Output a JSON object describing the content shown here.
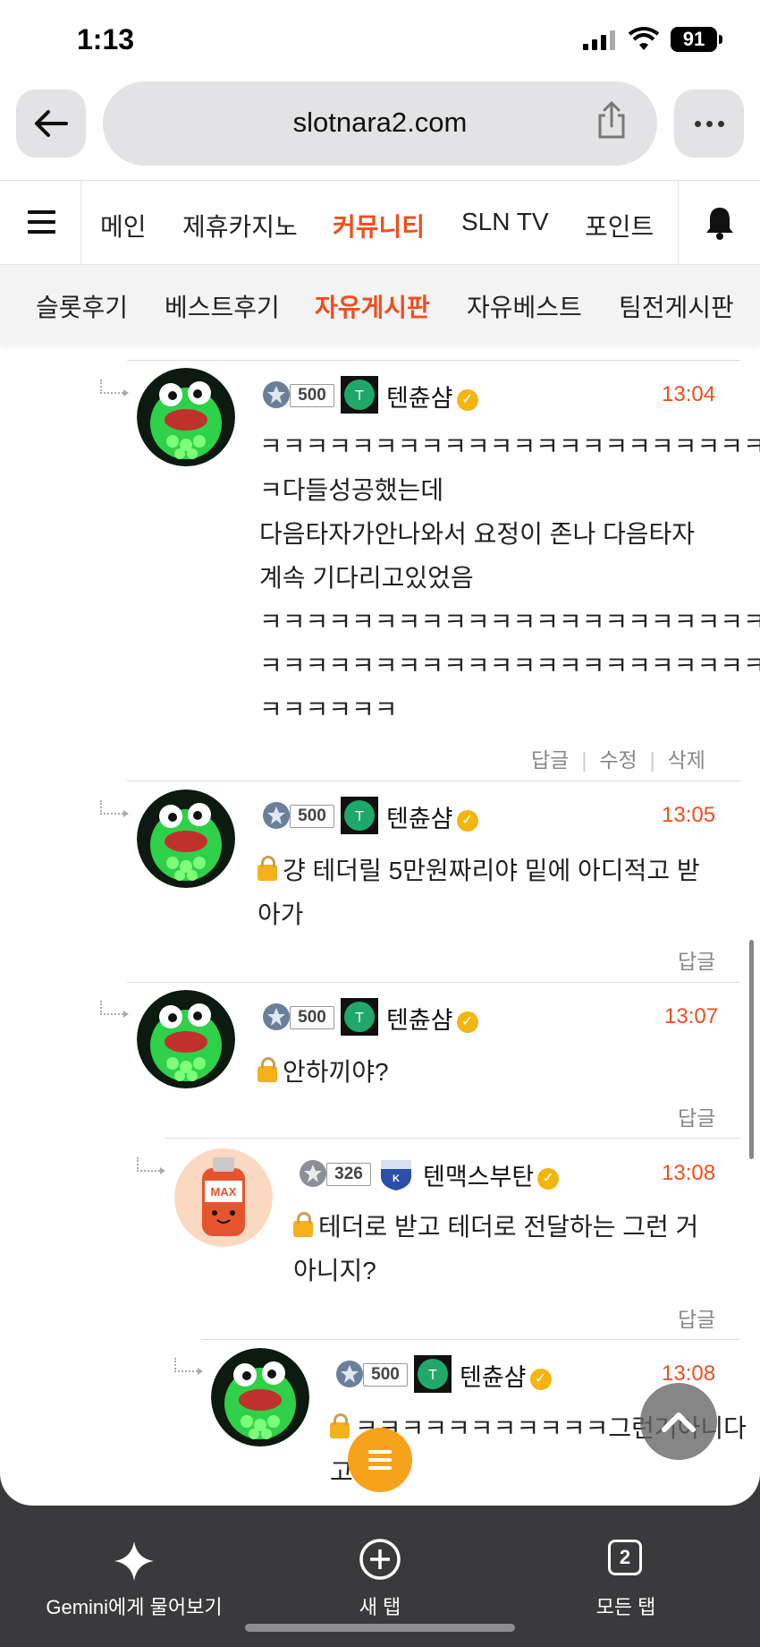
{
  "status_bar": {
    "time": "1:13",
    "battery": "91"
  },
  "browser": {
    "url": "slotnara2.com"
  },
  "nav": {
    "items": [
      "메인",
      "제휴카지노",
      "커뮤니티",
      "SLN TV",
      "포인트"
    ],
    "active": "커뮤니티"
  },
  "subnav": {
    "items": [
      "슬롯후기",
      "베스트후기",
      "자유게시판",
      "자유베스트",
      "팀전게시판"
    ],
    "active": "자유게시판"
  },
  "comments": [
    {
      "level": "500",
      "username": "텐츈샴",
      "time": "13:04",
      "locked": false,
      "lines": [
        "ㅋㅋㅋㅋㅋㅋㅋㅋㅋㅋㅋㅋㅋㅋㅋㅋㅋㅋㅋㅋㅋㅋㅋ",
        "ㅋ다들성공했는데",
        "다음타자가안나와서 요정이 존나 다음타자",
        "계속 기다리고있었음",
        "ㅋㅋㅋㅋㅋㅋㅋㅋㅋㅋㅋㅋㅋㅋㅋㅋㅋㅋㅋㅋㅋㅋㅋ",
        "ㅋㅋㅋㅋㅋㅋㅋㅋㅋㅋㅋㅋㅋㅋㅋㅋㅋㅋㅋㅋㅋㅋㅋ",
        "ㅋㅋㅋㅋㅋㅋ"
      ],
      "actions": [
        "답글",
        "수정",
        "삭제"
      ]
    },
    {
      "level": "500",
      "username": "텐츈샴",
      "time": "13:05",
      "locked": true,
      "lines": [
        "걍 테더릴 5만원짜리야 밑에 아디적고 받",
        "아가"
      ],
      "actions": [
        "답글"
      ]
    },
    {
      "level": "500",
      "username": "텐츈샴",
      "time": "13:07",
      "locked": true,
      "lines": [
        "안하끼야?"
      ],
      "actions": [
        "답글"
      ]
    },
    {
      "level": "326",
      "username": "텐맥스부탄",
      "time": "13:08",
      "locked": true,
      "avatar_label": "MAX BUTANE",
      "lines": [
        "테더로 받고 테더로 전달하는 그런 거",
        "아니지?"
      ],
      "actions": [
        "답글"
      ]
    },
    {
      "level": "500",
      "username": "텐츈샴",
      "time": "13:08",
      "locked": true,
      "lines": [
        "ㅋㅋㅋㅋㅋㅋㅋㅋㅋㅋㅋ그런거아니다",
        "고"
      ],
      "actions": []
    }
  ],
  "toolbar": {
    "gemini_label": "Gemini에게 물어보기",
    "new_tab_label": "새 탭",
    "tab_count": "2",
    "all_tabs_label": "모든 탭"
  },
  "colors": {
    "accent": "#f04e1c",
    "fab": "#f7a21b",
    "verified": "#f5b50f"
  }
}
